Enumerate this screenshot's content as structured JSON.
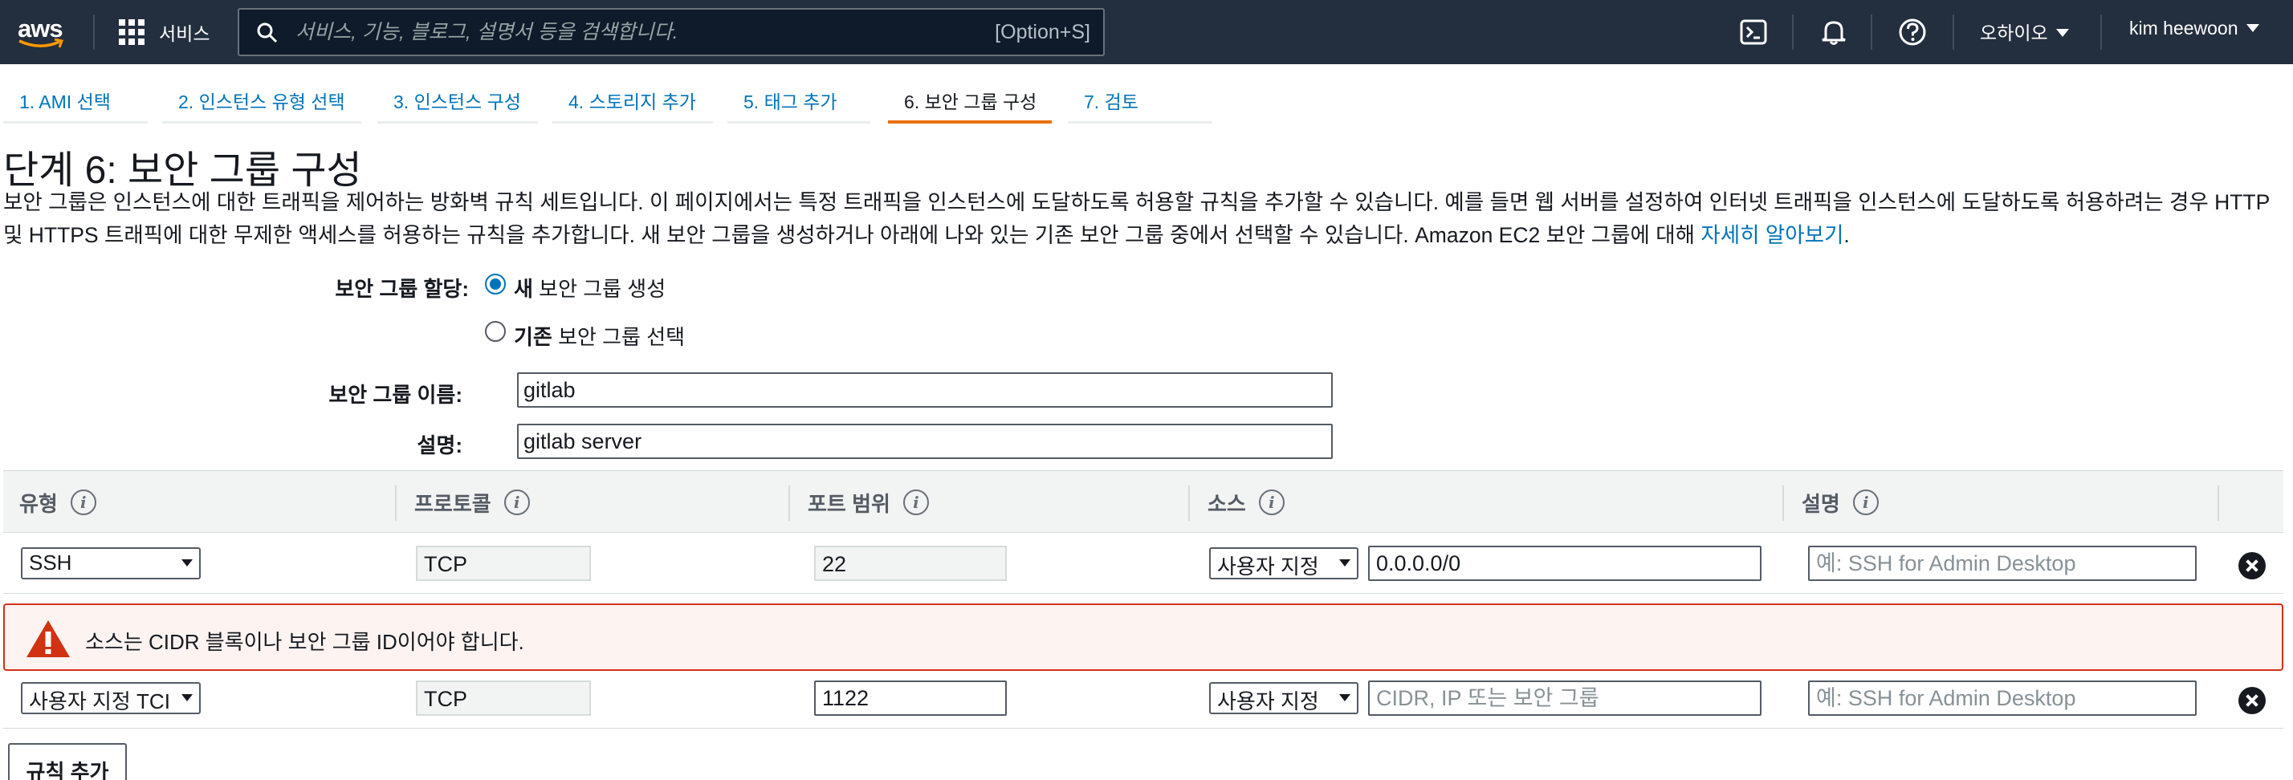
{
  "topnav": {
    "logo_text": "aws",
    "services_label": "서비스",
    "search_placeholder": "서비스, 기능, 블로그, 설명서 등을 검색합니다.",
    "search_shortcut": "[Option+S]",
    "region": "오하이오",
    "user": "kim heewoon",
    "icons": [
      "cloudshell-icon",
      "bell-icon",
      "help-icon"
    ]
  },
  "tabs": [
    {
      "label": "1. AMI 선택",
      "active": false
    },
    {
      "label": "2. 인스턴스 유형 선택",
      "active": false
    },
    {
      "label": "3. 인스턴스 구성",
      "active": false
    },
    {
      "label": "4. 스토리지 추가",
      "active": false
    },
    {
      "label": "5. 태그 추가",
      "active": false
    },
    {
      "label": "6. 보안 그룹 구성",
      "active": true
    },
    {
      "label": "7. 검토",
      "active": false
    }
  ],
  "page": {
    "title": "단계 6: 보안 그룹 구성",
    "desc_line1": "보안 그룹은 인스턴스에 대한 트래픽을 제어하는 방화벽 규칙 세트입니다. 이 페이지에서는 특정 트래픽을 인스턴스에 도달하도록 허용할 규칙을 추가할 수 있습니다. 예를 들면 웹 서버를 설정하여 인터넷 트래픽을 인스턴스에 도달하도록 허용하려는 경우 HTTP",
    "desc_line2": "및 HTTPS 트래픽에 대한 무제한 액세스를 허용하는 규칙을 추가합니다. 새 보안 그룹을 생성하거나 아래에 나와 있는 기존 보안 그룹 중에서 선택할 수 있습니다. Amazon EC2 보안 그룹에 대해 ",
    "desc_link": "자세히 알아보기",
    "desc_end": "."
  },
  "form": {
    "assign_label": "보안 그룹 할당:",
    "opt_new_bold": "새",
    "opt_new_rest": " 보안 그룹 생성",
    "opt_existing_bold": "기존",
    "opt_existing_rest": " 보안 그룹 선택",
    "selected": "new",
    "name_label": "보안 그룹 이름:",
    "name_value": "gitlab",
    "desc_label": "설명:",
    "desc_value": "gitlab server"
  },
  "table": {
    "headers": [
      "유형",
      "프로토콜",
      "포트 범위",
      "소스",
      "설명"
    ],
    "info_glyph": "i",
    "rows": [
      {
        "type": "SSH",
        "protocol": "TCP",
        "port": "22",
        "source_type": "사용자 지정",
        "source_value": "0.0.0.0/0",
        "source_placeholder": "CIDR, IP 또는 보안 그룹",
        "desc_placeholder": "예: SSH for Admin Desktop"
      },
      {
        "type": "사용자 지정 TCI",
        "protocol": "TCP",
        "port": "1122",
        "source_type": "사용자 지정",
        "source_value": "",
        "source_placeholder": "CIDR, IP 또는 보안 그룹",
        "desc_placeholder": "예: SSH for Admin Desktop"
      }
    ],
    "error": "소스는 CIDR 블록이나 보안 그룹 ID이어야 합니다."
  },
  "add_rule_label": "규칙 추가",
  "colors": {
    "nav_bg": "#232f3e",
    "link": "#0073bb",
    "tab_active": "#ec7211",
    "error_border": "#d13212",
    "error_bg": "#fdf3f1"
  }
}
